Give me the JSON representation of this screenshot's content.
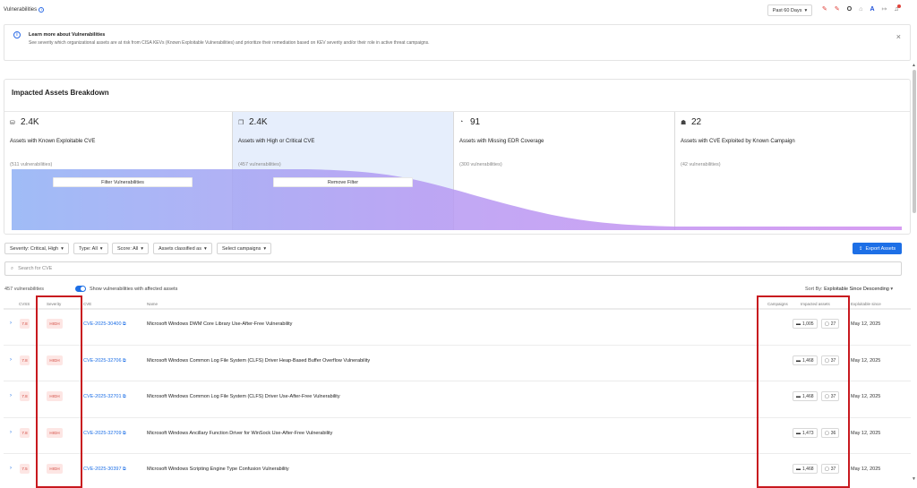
{
  "header": {
    "title": "Vulnerabilities",
    "period": "Past 60 Days"
  },
  "banner": {
    "title": "Learn more about Vulnerabilities",
    "description": "See severity which organizational assets are at risk from CISA KEVs (Known Exploitable Vulnerabilities) and prioritize their remediation based on KEV severity and/or their role in active threat campaigns."
  },
  "breakdown": {
    "title": "Impacted Assets Breakdown",
    "columns": [
      {
        "value": "2.4K",
        "label": "Assets with Known Exploitable CVE",
        "count": "(511 vulnerabilities)",
        "icon": "asset-icon"
      },
      {
        "value": "2.4K",
        "label": "Assets with High or Critical CVE",
        "count": "(457 vulnerabilities)",
        "icon": "layers-icon"
      },
      {
        "value": "91",
        "label": "Assets with Missing EDR Coverage",
        "count": "(300 vulnerabilities)",
        "icon": "shield-icon"
      },
      {
        "value": "22",
        "label": "Assets with CVE Exploited by Known Campaign",
        "count": "(42 vulnerabilities)",
        "icon": "bug-icon"
      }
    ],
    "filter_button": "Filter Vulnerabilities",
    "remove_button": "Remove Filter"
  },
  "filters": {
    "severity": "Severity: Critical, High",
    "type": "Type: All",
    "score": "Score: All",
    "assets_classified": "Assets classified as",
    "campaigns": "Select campaigns",
    "export": "Export Assets"
  },
  "search": {
    "placeholder": "Search for CVE"
  },
  "list": {
    "count": "457 vulnerabilities",
    "toggle_label": "Show vulnerabilities with affected assets",
    "sort_prefix": "Sort By:",
    "sort_value": "Exploitable Since Descending"
  },
  "table": {
    "headers": {
      "cvss": "CVSS",
      "severity": "Severity",
      "cve": "CVE",
      "name": "Name",
      "campaigns": "Campaigns",
      "impacted": "Impacted assets",
      "exploitable": "Exploitable since"
    },
    "rows": [
      {
        "cvss": "7.8",
        "severity": "HIGH",
        "cve": "CVE-2025-30400",
        "name": "Microsoft Windows DWM Core Library Use-After-Free Vulnerability",
        "assets": "1,005",
        "other": "27",
        "date": "May 12, 2025"
      },
      {
        "cvss": "7.8",
        "severity": "HIGH",
        "cve": "CVE-2025-32706",
        "name": "Microsoft Windows Common Log File System (CLFS) Driver Heap-Based Buffer Overflow Vulnerability",
        "assets": "1,468",
        "other": "37",
        "date": "May 12, 2025"
      },
      {
        "cvss": "7.8",
        "severity": "HIGH",
        "cve": "CVE-2025-32701",
        "name": "Microsoft Windows Common Log File System (CLFS) Driver Use-After-Free Vulnerability",
        "assets": "1,468",
        "other": "37",
        "date": "May 12, 2025"
      },
      {
        "cvss": "7.8",
        "severity": "HIGH",
        "cve": "CVE-2025-32709",
        "name": "Microsoft Windows Ancillary Function Driver for WinSock Use-After-Free Vulnerability",
        "assets": "1,473",
        "other": "36",
        "date": "May 12, 2025"
      },
      {
        "cvss": "7.5",
        "severity": "HIGH",
        "cve": "CVE-2025-30397",
        "name": "Microsoft Windows Scripting Engine Type Confusion Vulnerability",
        "assets": "1,468",
        "other": "37",
        "date": "May 12, 2025"
      }
    ]
  },
  "colors": {
    "accent": "#1d6fe6",
    "severity_high_bg": "#fde6e4",
    "severity_high_text": "#d0453c",
    "highlight": "#c8191f",
    "funnel_start": "#8fb0f5",
    "funnel_end": "#c98af0"
  }
}
